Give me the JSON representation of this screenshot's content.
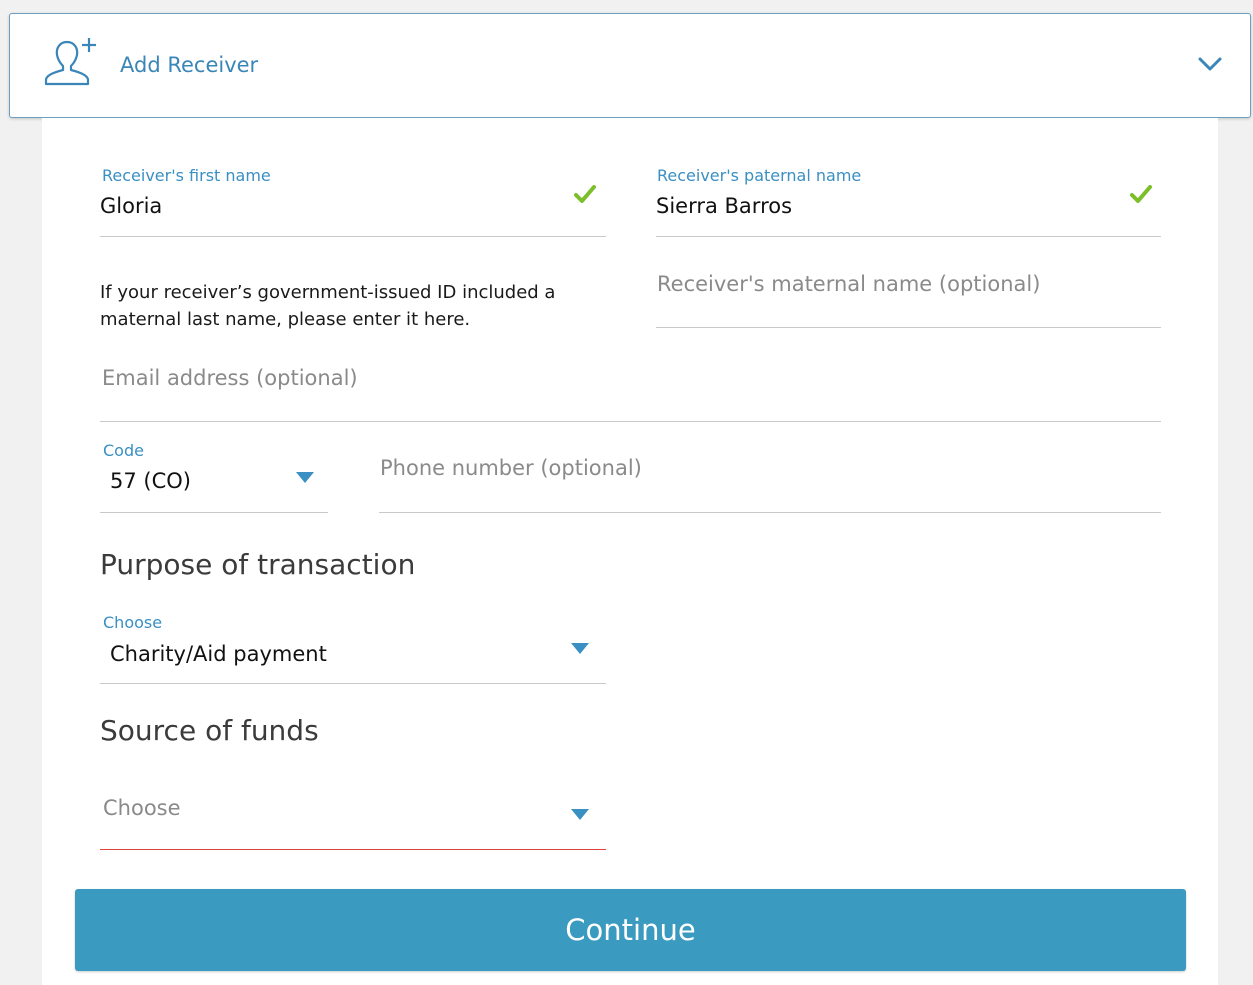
{
  "header": {
    "title": "Add Receiver",
    "icon": "add-person-icon",
    "toggle_icon": "chevron-down-icon"
  },
  "form": {
    "first_name": {
      "label": "Receiver's first name",
      "value": "Gloria",
      "valid": true
    },
    "paternal_name": {
      "label": "Receiver's paternal name",
      "value": "Sierra Barros",
      "valid": true
    },
    "maternal_hint": "If your receiver’s government-issued ID included a maternal last name, please enter it here.",
    "maternal_name": {
      "placeholder": "Receiver's maternal name (optional)",
      "value": ""
    },
    "email": {
      "placeholder": "Email address (optional)",
      "value": ""
    },
    "phone_code": {
      "label": "Code",
      "value": "57 (CO)"
    },
    "phone_number": {
      "placeholder": "Phone number (optional)",
      "value": ""
    },
    "purpose": {
      "section_title": "Purpose of transaction",
      "label": "Choose",
      "value": "Charity/Aid payment"
    },
    "source": {
      "section_title": "Source of funds",
      "placeholder": "Choose",
      "value": "",
      "error": true
    }
  },
  "actions": {
    "continue_label": "Continue"
  },
  "colors": {
    "accent": "#3a8fc3",
    "button": "#3b9abf",
    "valid": "#7cbf2a",
    "error": "#e0433b"
  }
}
